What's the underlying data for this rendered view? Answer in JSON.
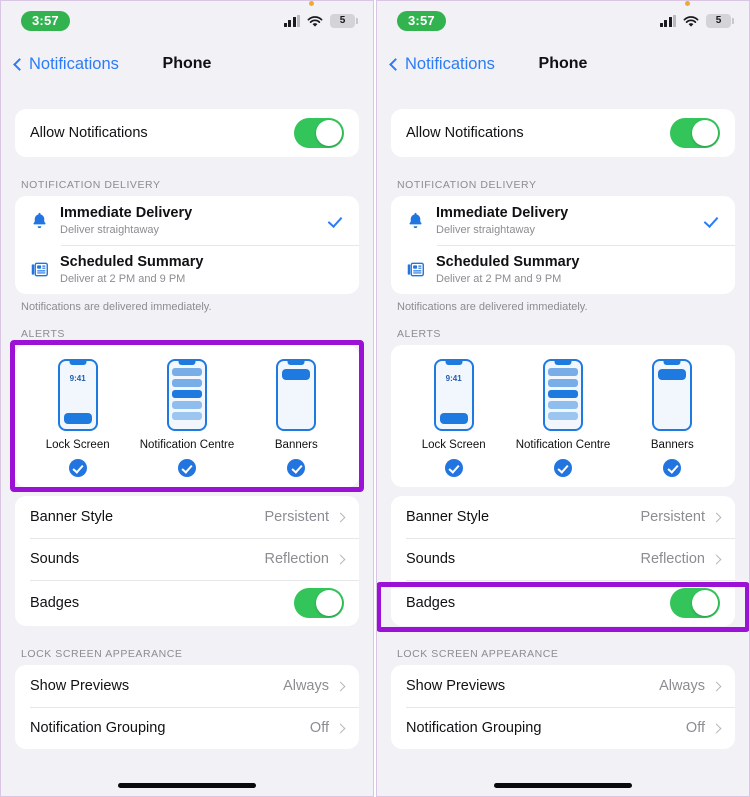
{
  "panels": [
    {
      "id": "left",
      "statusbar": {
        "time": "3:57",
        "battery": "5",
        "signal_icon": "cellular-signal-icon",
        "wifi_icon": "wifi-icon",
        "battery_icon": "battery-icon",
        "recording_dot_icon": "recording-indicator-dot"
      },
      "nav": {
        "back_label": "Notifications",
        "title": "Phone"
      },
      "allow": {
        "label": "Allow Notifications",
        "toggle_state": "on"
      },
      "delivery": {
        "header": "NOTIFICATION DELIVERY",
        "footer": "Notifications are delivered immediately.",
        "rows": [
          {
            "title": "Immediate Delivery",
            "subtitle": "Deliver straightaway",
            "icon": "bell-icon",
            "selected": true
          },
          {
            "title": "Scheduled Summary",
            "subtitle": "Deliver at 2 PM and 9 PM",
            "icon": "summary-newspaper-icon",
            "selected": false
          }
        ]
      },
      "alerts": {
        "header": "ALERTS",
        "options": [
          {
            "label": "Lock Screen",
            "mock_time": "9:41",
            "checked": true
          },
          {
            "label": "Notification Centre",
            "checked": true
          },
          {
            "label": "Banners",
            "checked": true
          }
        ]
      },
      "options_rows": [
        {
          "label": "Banner Style",
          "value": "Persistent",
          "type": "disclosure"
        },
        {
          "label": "Sounds",
          "value": "Reflection",
          "type": "disclosure"
        },
        {
          "label": "Badges",
          "type": "toggle",
          "toggle_state": "on"
        }
      ],
      "lock_screen": {
        "header": "LOCK SCREEN APPEARANCE",
        "rows": [
          {
            "label": "Show Previews",
            "value": "Always",
            "type": "disclosure"
          },
          {
            "label": "Notification Grouping",
            "value": "Off",
            "type": "disclosure"
          }
        ]
      },
      "highlight_target": "alerts"
    },
    {
      "id": "right",
      "statusbar": {
        "time": "3:57",
        "battery": "5",
        "signal_icon": "cellular-signal-icon",
        "wifi_icon": "wifi-icon",
        "battery_icon": "battery-icon",
        "recording_dot_icon": "recording-indicator-dot"
      },
      "nav": {
        "back_label": "Notifications",
        "title": "Phone"
      },
      "allow": {
        "label": "Allow Notifications",
        "toggle_state": "on"
      },
      "delivery": {
        "header": "NOTIFICATION DELIVERY",
        "footer": "Notifications are delivered immediately.",
        "rows": [
          {
            "title": "Immediate Delivery",
            "subtitle": "Deliver straightaway",
            "icon": "bell-icon",
            "selected": true
          },
          {
            "title": "Scheduled Summary",
            "subtitle": "Deliver at 2 PM and 9 PM",
            "icon": "summary-newspaper-icon",
            "selected": false
          }
        ]
      },
      "alerts": {
        "header": "ALERTS",
        "options": [
          {
            "label": "Lock Screen",
            "mock_time": "9:41",
            "checked": true
          },
          {
            "label": "Notification Centre",
            "checked": true
          },
          {
            "label": "Banners",
            "checked": true
          }
        ]
      },
      "options_rows": [
        {
          "label": "Banner Style",
          "value": "Persistent",
          "type": "disclosure"
        },
        {
          "label": "Sounds",
          "value": "Reflection",
          "type": "disclosure"
        },
        {
          "label": "Badges",
          "type": "toggle",
          "toggle_state": "on"
        }
      ],
      "lock_screen": {
        "header": "LOCK SCREEN APPEARANCE",
        "rows": [
          {
            "label": "Show Previews",
            "value": "Always",
            "type": "disclosure"
          },
          {
            "label": "Notification Grouping",
            "value": "Off",
            "type": "disclosure"
          }
        ]
      },
      "highlight_target": "badges"
    }
  ],
  "colors": {
    "highlight": "#9b12d6",
    "toggle_on": "#33c45a",
    "accent_blue": "#2b7cf6",
    "mock_blue": "#1f7ae0",
    "time_pill_green": "#32b350",
    "page_bg": "#f2f1f5",
    "card_bg": "#ffffff",
    "secondary_text": "#8c8c92"
  }
}
